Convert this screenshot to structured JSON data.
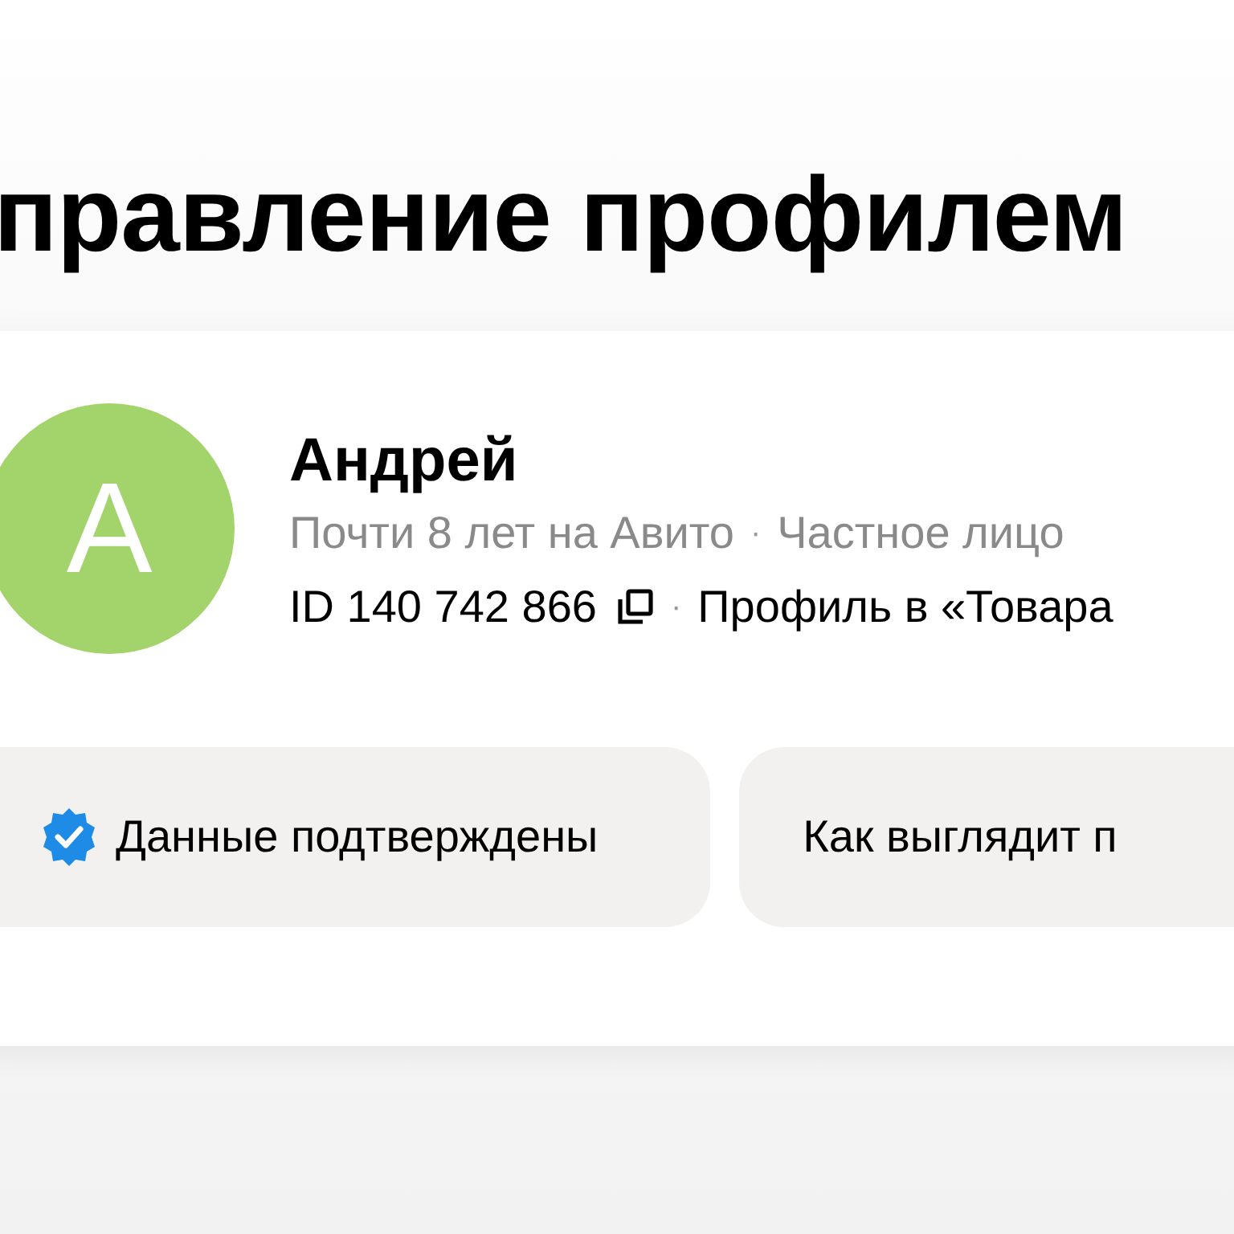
{
  "page_title": "правление профилем",
  "profile": {
    "avatar_letter": "A",
    "name": "Андрей",
    "tenure": "Почти 8 лет на Авито",
    "separator_1": "·",
    "account_type": "Частное лицо",
    "separator_2": "·",
    "id": "ID 140 742 866",
    "profile_link": "Профиль в «Товара"
  },
  "buttons": [
    {
      "kind": "verified",
      "label": "Данные подтверждены"
    },
    {
      "kind": "plain",
      "label": "Как выглядит п"
    }
  ]
}
